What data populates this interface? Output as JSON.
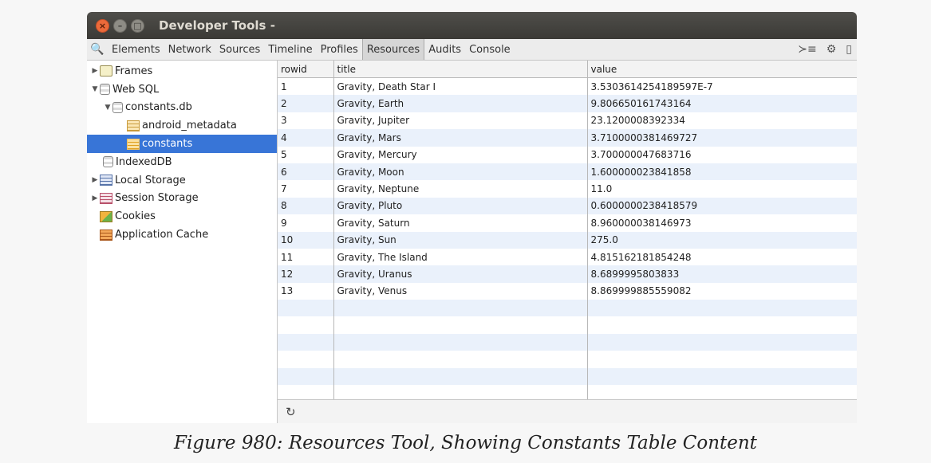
{
  "window": {
    "title": "Developer Tools -",
    "close_glyph": "×",
    "min_glyph": "–",
    "max_glyph": "□"
  },
  "toolbar": {
    "search_glyph": "🔍",
    "tabs": [
      "Elements",
      "Network",
      "Sources",
      "Timeline",
      "Profiles",
      "Resources",
      "Audits",
      "Console"
    ],
    "active_tab": "Resources",
    "console_glyph": "≻≡",
    "settings_glyph": "⚙",
    "dock_glyph": "▯"
  },
  "sidebar": {
    "frames": "Frames",
    "websql": "Web SQL",
    "database": "constants.db",
    "table1": "android_metadata",
    "table2": "constants",
    "indexeddb": "IndexedDB",
    "local_storage": "Local Storage",
    "session_storage": "Session Storage",
    "cookies": "Cookies",
    "app_cache": "Application Cache",
    "expanded_glyph": "▼",
    "collapsed_glyph": "▶"
  },
  "grid": {
    "columns": [
      "rowid",
      "title",
      "value"
    ],
    "rows": [
      [
        "1",
        "Gravity, Death Star I",
        "3.5303614254189597E-7"
      ],
      [
        "2",
        "Gravity, Earth",
        "9.806650161743164"
      ],
      [
        "3",
        "Gravity, Jupiter",
        "23.1200008392334"
      ],
      [
        "4",
        "Gravity, Mars",
        "3.7100000381469727"
      ],
      [
        "5",
        "Gravity, Mercury",
        "3.700000047683716"
      ],
      [
        "6",
        "Gravity, Moon",
        "1.600000023841858"
      ],
      [
        "7",
        "Gravity, Neptune",
        "11.0"
      ],
      [
        "8",
        "Gravity, Pluto",
        "0.6000000238418579"
      ],
      [
        "9",
        "Gravity, Saturn",
        "8.960000038146973"
      ],
      [
        "10",
        "Gravity, Sun",
        "275.0"
      ],
      [
        "11",
        "Gravity, The Island",
        "4.815162181854248"
      ],
      [
        "12",
        "Gravity, Uranus",
        "8.6899995803833"
      ],
      [
        "13",
        "Gravity, Venus",
        "8.869999885559082"
      ]
    ],
    "refresh_glyph": "↻"
  },
  "caption": "Figure 980: Resources Tool, Showing Constants Table Content"
}
